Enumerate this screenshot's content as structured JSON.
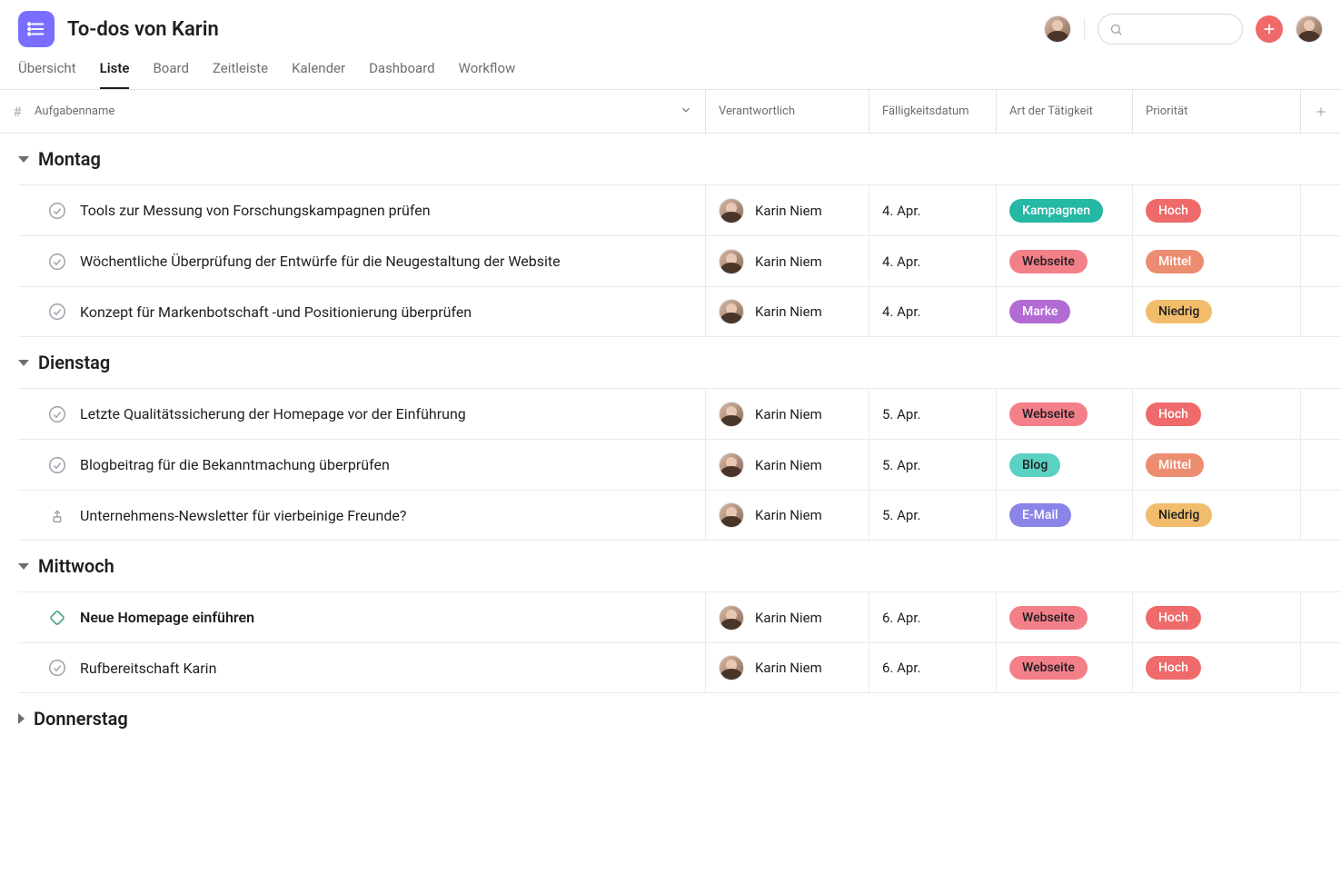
{
  "project": {
    "title": "To-dos von Karin"
  },
  "tabs": [
    {
      "label": "Übersicht",
      "active": false
    },
    {
      "label": "Liste",
      "active": true
    },
    {
      "label": "Board",
      "active": false
    },
    {
      "label": "Zeitleiste",
      "active": false
    },
    {
      "label": "Kalender",
      "active": false
    },
    {
      "label": "Dashboard",
      "active": false
    },
    {
      "label": "Workflow",
      "active": false
    }
  ],
  "columns": {
    "hash": "#",
    "name": "Aufgabenname",
    "assignee": "Verantwortlich",
    "due": "Fälligkeitsdatum",
    "type": "Art der Tätigkeit",
    "priority": "Priorität"
  },
  "tag_colors": {
    "Kampagnen": "#25b8a4",
    "Webseite": "#f37f89",
    "Marke": "#b36bd4",
    "Blog": "#5bd1c3",
    "E-Mail": "#8b84e8",
    "Hoch": "#ef6a6a",
    "Mittel": "#ec8d71",
    "Niedrig": "#f1bd6c"
  },
  "sections": [
    {
      "name": "Montag",
      "collapsed": false,
      "tasks": [
        {
          "icon": "check",
          "name": "Tools zur Messung von Forschungskampagnen prüfen",
          "bold": false,
          "assignee": "Karin Niem",
          "due": "4. Apr.",
          "type": "Kampagnen",
          "type_dark": false,
          "priority": "Hoch",
          "priority_dark": false
        },
        {
          "icon": "check",
          "name": "Wöchentliche Überprüfung der Entwürfe für die Neugestaltung der Website",
          "bold": false,
          "assignee": "Karin Niem",
          "due": "4. Apr.",
          "type": "Webseite",
          "type_dark": true,
          "priority": "Mittel",
          "priority_dark": false
        },
        {
          "icon": "check",
          "name": "Konzept für Markenbotschaft -und Positionierung überprüfen",
          "bold": false,
          "assignee": "Karin Niem",
          "due": "4. Apr.",
          "type": "Marke",
          "type_dark": false,
          "priority": "Niedrig",
          "priority_dark": true
        }
      ]
    },
    {
      "name": "Dienstag",
      "collapsed": false,
      "tasks": [
        {
          "icon": "check",
          "name": "Letzte Qualitätssicherung der Homepage vor der Einführung",
          "bold": false,
          "assignee": "Karin Niem",
          "due": "5. Apr.",
          "type": "Webseite",
          "type_dark": true,
          "priority": "Hoch",
          "priority_dark": false
        },
        {
          "icon": "check",
          "name": "Blogbeitrag für die Bekanntmachung überprüfen",
          "bold": false,
          "assignee": "Karin Niem",
          "due": "5. Apr.",
          "type": "Blog",
          "type_dark": true,
          "priority": "Mittel",
          "priority_dark": false
        },
        {
          "icon": "approval",
          "name": "Unternehmens-Newsletter für vierbeinige Freunde?",
          "bold": false,
          "assignee": "Karin Niem",
          "due": "5. Apr.",
          "type": "E-Mail",
          "type_dark": false,
          "priority": "Niedrig",
          "priority_dark": true
        }
      ]
    },
    {
      "name": "Mittwoch",
      "collapsed": false,
      "tasks": [
        {
          "icon": "milestone",
          "name": "Neue Homepage einführen",
          "bold": true,
          "assignee": "Karin Niem",
          "due": "6. Apr.",
          "type": "Webseite",
          "type_dark": true,
          "priority": "Hoch",
          "priority_dark": false
        },
        {
          "icon": "check",
          "name": "Rufbereitschaft Karin",
          "bold": false,
          "assignee": "Karin Niem",
          "due": "6. Apr.",
          "type": "Webseite",
          "type_dark": true,
          "priority": "Hoch",
          "priority_dark": false
        }
      ]
    },
    {
      "name": "Donnerstag",
      "collapsed": true,
      "tasks": []
    }
  ]
}
